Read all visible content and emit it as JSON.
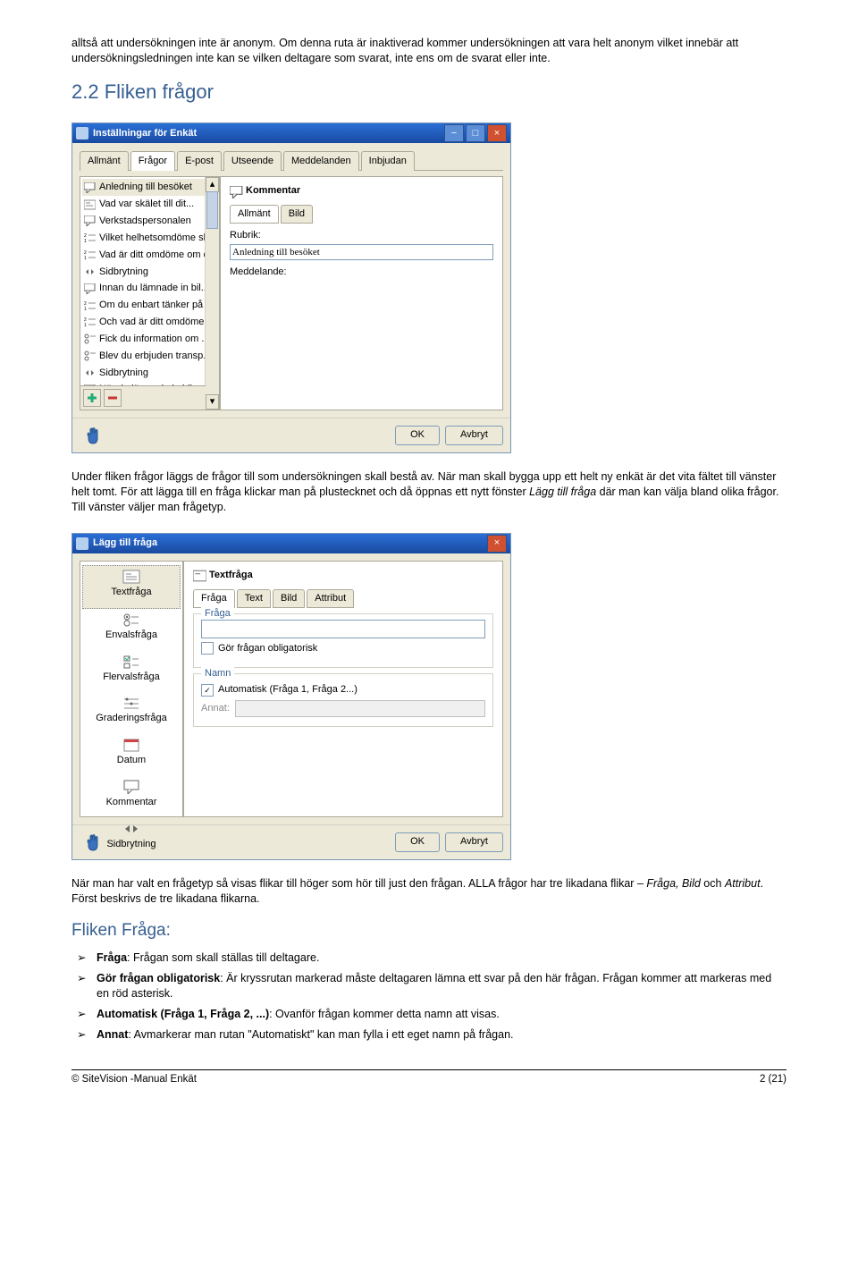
{
  "intro_para": "alltså att undersökningen inte är anonym. Om denna ruta är inaktiverad kommer undersökningen att vara helt anonym vilket innebär att undersökningsledningen inte kan se vilken deltagare som svarat, inte ens om de svarat eller inte.",
  "heading_22": "2.2 Fliken frågor",
  "win1": {
    "title": "Inställningar för Enkät",
    "tabs": [
      "Allmänt",
      "Frågor",
      "E-post",
      "Utseende",
      "Meddelanden",
      "Inbjudan"
    ],
    "active_tab": 1,
    "questions": [
      "Anledning till besöket",
      "Vad var skälet till dit...",
      "Verkstadspersonalen",
      "Vilket helhetsomdöme sk...",
      "Vad är ditt omdöme om d...",
      "Sidbrytning",
      "Innan du lämnade in bil...",
      "Om du enbart tänker på ...",
      "Och vad är ditt omdöme ...",
      "Fick du information om ...",
      "Blev du erbjuden transp...",
      "Sidbrytning",
      "När du lämnade in bilen..."
    ],
    "right_title": "Kommentar",
    "right_subtabs": [
      "Allmänt",
      "Bild"
    ],
    "rubrik_label": "Rubrik:",
    "rubrik_value": "Anledning till besöket",
    "meddelande_label": "Meddelande:",
    "ok": "OK",
    "cancel": "Avbryt"
  },
  "para_after_win1_a": "Under fliken frågor läggs de frågor till som undersökningen skall bestå av. När man skall bygga upp ett helt ny enkät är det vita fältet till vänster helt tomt. För att lägga till en fråga klickar man på plustecknet och då öppnas ett nytt fönster ",
  "para_after_win1_ital": "Lägg till fråga",
  "para_after_win1_b": " där man kan välja bland olika frågor. Till vänster väljer man frågetyp.",
  "win2": {
    "title": "Lägg till fråga",
    "types": [
      "Textfråga",
      "Envalsfråga",
      "Flervalsfråga",
      "Graderingsfråga",
      "Datum",
      "Kommentar",
      "Sidbrytning"
    ],
    "right_title": "Textfråga",
    "right_subtabs": [
      "Fråga",
      "Text",
      "Bild",
      "Attribut"
    ],
    "fset_fraga": "Fråga",
    "obligatorisk": "Gör frågan obligatorisk",
    "fset_namn": "Namn",
    "automatisk": "Automatisk (Fråga 1, Fråga 2...)",
    "annat": "Annat:",
    "ok": "OK",
    "cancel": "Avbryt"
  },
  "para_after_win2_a": "När man har valt en frågetyp så visas flikar till höger som hör till just den frågan. ALLA frågor har tre likadana flikar – ",
  "para_after_win2_ital": "Fråga, Bild",
  "para_after_win2_b": " och ",
  "para_after_win2_ital2": "Attribut",
  "para_after_win2_c": ".  Först beskrivs de tre likadana flikarna.",
  "heading_fliken_fraga": "Fliken Fråga:",
  "bullets": [
    {
      "b": "Fråga",
      "rest": ": Frågan som skall ställas till deltagare."
    },
    {
      "b": "Gör frågan obligatorisk",
      "rest": ": Är kryssrutan markerad måste deltagaren lämna ett svar på den här frågan. Frågan kommer att markeras med en röd asterisk."
    },
    {
      "b": "Automatisk (Fråga 1, Fråga 2, ...)",
      "rest": ": Ovanför frågan kommer detta namn att visas."
    },
    {
      "b": "Annat",
      "rest": ": Avmarkerar man rutan \"Automatiskt\" kan man fylla i ett eget namn på frågan."
    }
  ],
  "footer_left": "© SiteVision -Manual Enkät",
  "footer_right": "2 (21)"
}
